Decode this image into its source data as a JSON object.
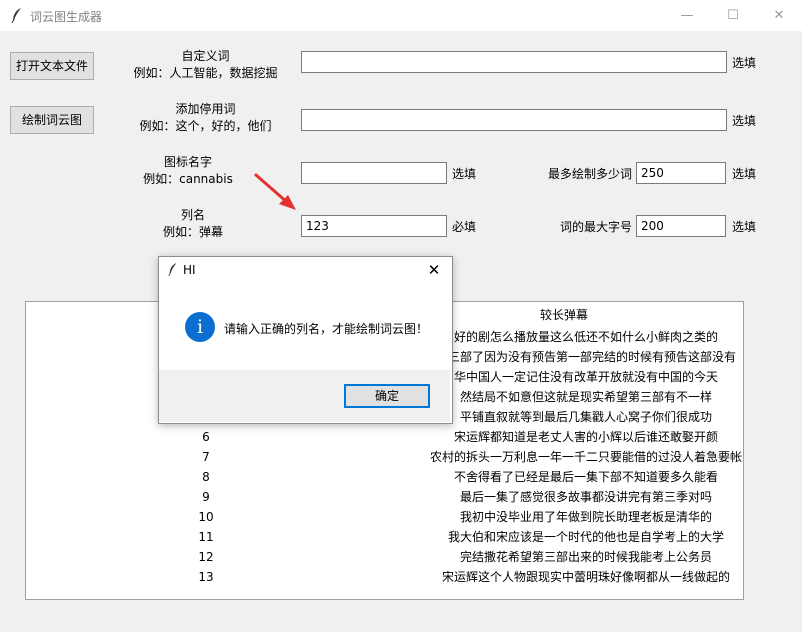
{
  "window": {
    "title": "词云图生成器",
    "controls": {
      "minimize": "—",
      "maximize": "☐",
      "close": "✕"
    }
  },
  "buttons": {
    "open_file": "打开文本文件",
    "draw": "绘制词云图"
  },
  "fields": {
    "custom_words": {
      "label": "自定义词",
      "example": "例如：人工智能，数据挖掘",
      "value": "",
      "hint": "选填"
    },
    "stop_words": {
      "label": "添加停用词",
      "example": "例如：这个，好的，他们",
      "value": "",
      "hint": "选填"
    },
    "icon_name": {
      "label": "图标名字",
      "example": "例如：cannabis",
      "value": "",
      "hint": "选填"
    },
    "column_name": {
      "label": "列名",
      "example": "例如：弹幕",
      "value": "123",
      "hint": "必填"
    },
    "max_words": {
      "label": "最多绘制多少词",
      "value": "250",
      "hint": "选填"
    },
    "max_font": {
      "label": "词的最大字号",
      "value": "200",
      "hint": "选填"
    }
  },
  "table": {
    "header_text": "较长弹幕",
    "rows": [
      {
        "idx": "",
        "text": "好的剧怎么播放量这么低还不如什么小鲜肉之类的"
      },
      {
        "idx": "",
        "text": "第三部了因为没有预告第一部完结的时候有预告这部没有"
      },
      {
        "idx": "",
        "text": "华中国人一定记住没有改革开放就没有中国的今天"
      },
      {
        "idx": "",
        "text": "然结局不如意但这就是现实希望第三部有不一样"
      },
      {
        "idx": "",
        "text": "平铺直叙就等到最后几集戳人心窝子你们很成功"
      },
      {
        "idx": "6",
        "text": "宋运辉都知道是老丈人害的小辉以后谁还敢娶开颜"
      },
      {
        "idx": "7",
        "text": "农村的拆头一万利息一年一千二只要能借的过没人着急要帐"
      },
      {
        "idx": "8",
        "text": "不舍得看了已经是最后一集下部不知道要多久能看"
      },
      {
        "idx": "9",
        "text": "最后一集了感觉很多故事都没讲完有第三季对吗"
      },
      {
        "idx": "10",
        "text": "我初中没毕业用了年做到院长助理老板是清华的"
      },
      {
        "idx": "11",
        "text": "我大伯和宋应该是一个时代的他也是自学考上的大学"
      },
      {
        "idx": "12",
        "text": "完结撒花希望第三部出来的时候我能考上公务员"
      },
      {
        "idx": "13",
        "text": "宋运辉这个人物跟现实中蕾明珠好像啊都从一线做起的"
      }
    ]
  },
  "dialog": {
    "title": "HI",
    "message": "请输入正确的列名，才能绘制词云图！",
    "ok": "确定",
    "close": "✕",
    "info_glyph": "i"
  },
  "colors": {
    "arrow": "#e53030",
    "info": "#0a6fd1",
    "focus": "#0078d7"
  }
}
